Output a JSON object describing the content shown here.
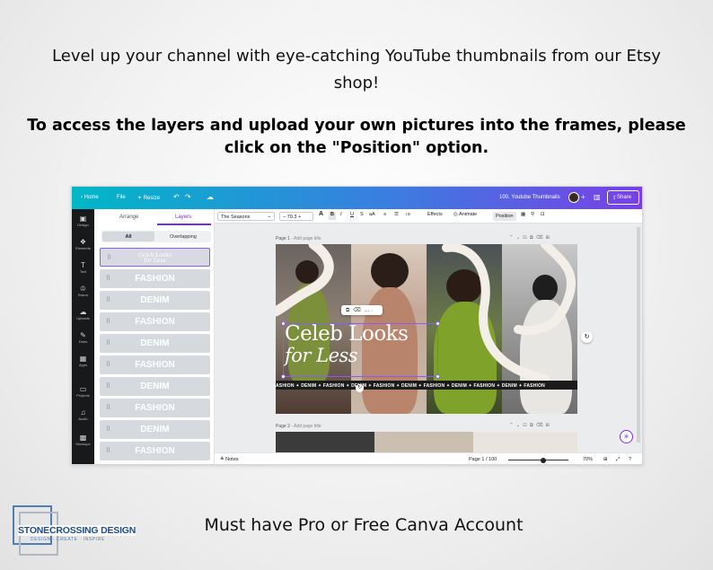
{
  "intro_text": "Level up your channel with eye-catching YouTube thumbnails from our Etsy shop!",
  "instruction_text": "To access the layers and upload your own pictures into the frames, please click on the \"Position\" option.",
  "footer_text": "Must have Pro or Free Canva Account",
  "logo": {
    "name": "STONECROSSING DESIGN",
    "tagline": "DESIGN · CREATE · INSPIRE",
    "color": "#1d4e86"
  },
  "canva": {
    "topbar": {
      "home": "‹  Home",
      "file": "File",
      "resize": "✦ Resize",
      "title": "100. Youtube Thumbnails",
      "share": "Share",
      "gradient": [
        "#00b7c7",
        "#3a7ee0",
        "#7a3fe6"
      ]
    },
    "rail": [
      {
        "icon": "design-icon",
        "glyph": "▣",
        "label": "Design"
      },
      {
        "icon": "elements-icon",
        "glyph": "❖",
        "label": "Elements"
      },
      {
        "icon": "text-icon",
        "glyph": "T",
        "label": "Text"
      },
      {
        "icon": "brand-icon",
        "glyph": "♔",
        "label": "Brand"
      },
      {
        "icon": "uploads-icon",
        "glyph": "☁",
        "label": "Uploads"
      },
      {
        "icon": "draw-icon",
        "glyph": "✎",
        "label": "Draw"
      },
      {
        "icon": "apps-icon",
        "glyph": "▦",
        "label": "Apps"
      },
      {
        "icon": "projects-icon",
        "glyph": "▭",
        "label": "Projects"
      },
      {
        "icon": "audio-icon",
        "glyph": "♫",
        "label": "Audio"
      },
      {
        "icon": "mockups-icon",
        "glyph": "▩",
        "label": "Mockups"
      }
    ],
    "panel": {
      "tabs": [
        "Arrange",
        "Layers"
      ],
      "active_tab": "Layers",
      "segments": [
        "All",
        "Overlapping"
      ],
      "layers": [
        {
          "label": "Celeb Looks\nfor Less",
          "selected": true
        },
        {
          "label": "FASHION"
        },
        {
          "label": "DENIM"
        },
        {
          "label": "FASHION"
        },
        {
          "label": "DENIM"
        },
        {
          "label": "FASHION"
        },
        {
          "label": "DENIM"
        },
        {
          "label": "FASHION"
        },
        {
          "label": "DENIM"
        },
        {
          "label": "FASHION"
        }
      ]
    },
    "context_toolbar": {
      "font": "The Seasons",
      "size": "70.3",
      "effects": "Effects",
      "animate": "Animate",
      "position": "Position"
    },
    "page1_label": "Page 1",
    "page2_label": "Page 2",
    "add_page_title": "- Add page title",
    "design": {
      "headline_line1": "Celeb Looks",
      "headline_line2": "for Less",
      "strip": "ASHION  ✦  DENIM  ✦  FASHION  ✦  DENIM  ✦  FASHION  ✦  DENIM  ✦  FASHION  ✦  DENIM  ✦  FASHION  ✦  DENIM  ✦  FASHION"
    },
    "bottombar": {
      "notes": "Notes",
      "page_indicator": "Page 1 / 100",
      "zoom": "70%"
    }
  }
}
